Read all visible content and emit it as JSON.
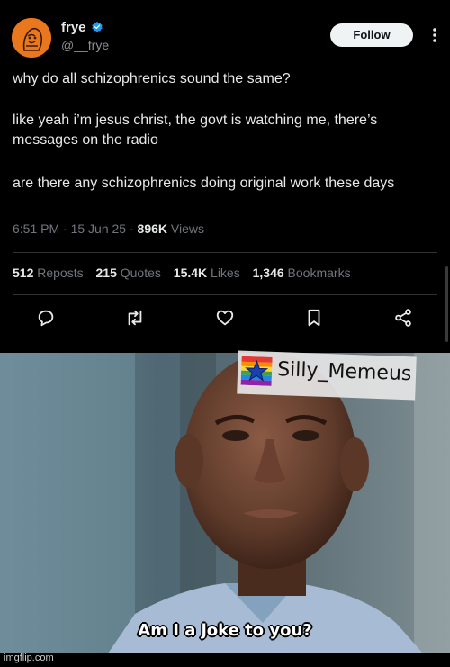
{
  "tweet": {
    "author_name": "frye",
    "handle": "@__frye",
    "follow_label": "Follow",
    "body": [
      "why do all schizophrenics sound the same?",
      "like yeah i’m jesus christ, the govt is watching me, there’s messages on the radio",
      "are there any schizophrenics doing original work these days"
    ],
    "meta": {
      "time": "6:51 PM · 15 Jun 25 · ",
      "views_count": "896K",
      "views_label": " Views"
    },
    "stats": [
      {
        "count": "512",
        "label": "Reposts"
      },
      {
        "count": "215",
        "label": "Quotes"
      },
      {
        "count": "15.4K",
        "label": "Likes"
      },
      {
        "count": "1,346",
        "label": "Bookmarks"
      }
    ],
    "icons": {
      "verified": "verified-badge-icon",
      "more": "more-icon",
      "actions": [
        "reply-icon",
        "repost-icon",
        "like-icon",
        "bookmark-icon",
        "share-icon"
      ]
    },
    "colors": {
      "background": "#000000",
      "text": "#e7e9ea",
      "muted": "#71767b",
      "verified": "#1d9bf0",
      "avatar": "#e8771e"
    }
  },
  "meme": {
    "watermark": "Silly_Memeus",
    "subtitle": "Am I a joke to you?",
    "site_credit": "imgflip.com"
  }
}
